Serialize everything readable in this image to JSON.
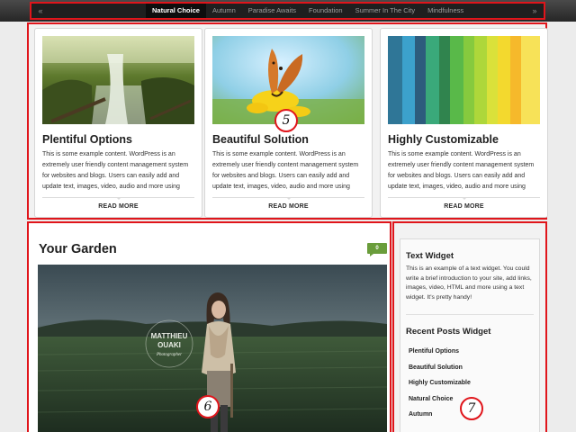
{
  "slider": {
    "prev_arrow": "«",
    "next_arrow": "»",
    "tabs": [
      {
        "label": "Natural Choice",
        "active": true
      },
      {
        "label": "Autumn",
        "active": false
      },
      {
        "label": "Paradise Awaits",
        "active": false
      },
      {
        "label": "Foundation",
        "active": false
      },
      {
        "label": "Summer In The City",
        "active": false
      },
      {
        "label": "Mindfulness",
        "active": false
      }
    ]
  },
  "features": [
    {
      "title": "Plentiful Options",
      "text": "This is some example content. WordPress is an extremely user friendly content management system for websites and blogs. Users can easily add and update text, images, video, audio and more using",
      "read_more": "READ MORE"
    },
    {
      "title": "Beautiful Solution",
      "text": "This is some example content. WordPress is an extremely user friendly content management system for websites and blogs. Users can easily add and update text, images, video, audio and more using",
      "read_more": "READ MORE"
    },
    {
      "title": "Highly Customizable",
      "text": "This is some example content. WordPress is an extremely user friendly content management system for websites and blogs. Users can easily add and update text, images, video, audio and more using",
      "read_more": "READ MORE"
    }
  ],
  "post": {
    "title": "Your Garden",
    "comment_count": "0",
    "image_caption": {
      "line1": "MATTHIEU",
      "line2": "OUAKI",
      "line3": "Photographer"
    }
  },
  "sidebar": {
    "text_widget": {
      "title": "Text Widget",
      "text": "This is an example of a text widget. You could write a brief introduction to your site, add links, images, video, HTML and more using a text widget. It's pretty handy!"
    },
    "recent_posts": {
      "title": "Recent Posts Widget",
      "items": [
        "Plentiful Options",
        "Beautiful Solution",
        "Highly Customizable",
        "Natural Choice",
        "Autumn"
      ]
    }
  },
  "markers": [
    "5",
    "6",
    "7"
  ],
  "colors": {
    "annotation_border": "#e0151b",
    "comment_badge": "#6a9d3b",
    "nav_background": "#1f1f1f",
    "active_tab": "#0d0d0d"
  },
  "icons": {
    "prev": "chevron-left-double-icon",
    "next": "chevron-right-double-icon",
    "comment": "comment-bubble-icon"
  }
}
